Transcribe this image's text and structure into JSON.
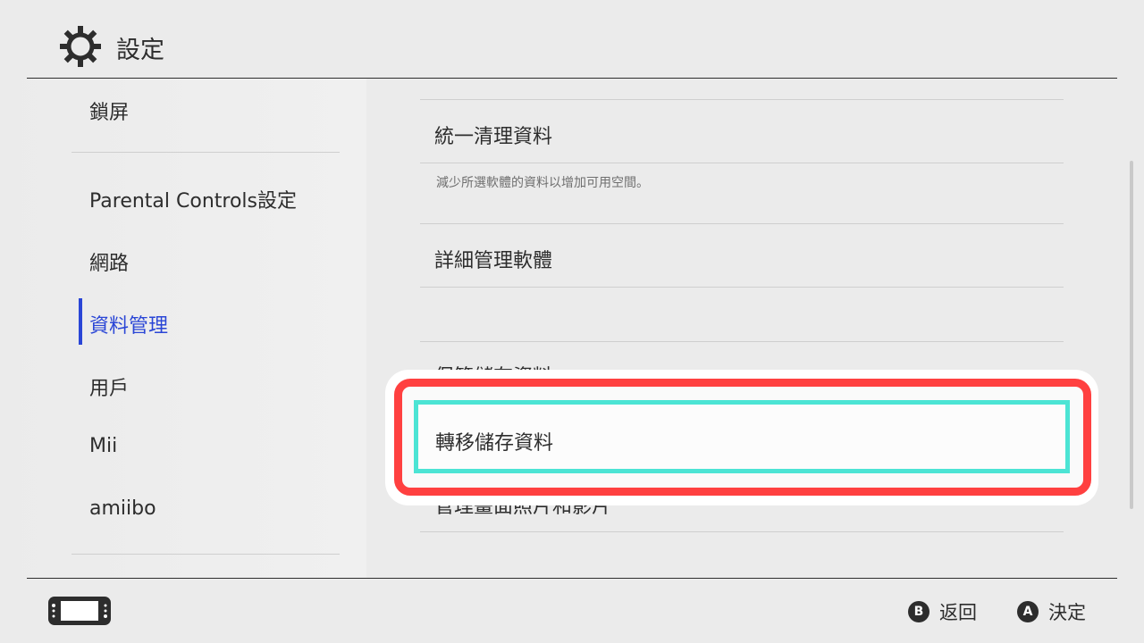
{
  "header": {
    "title": "設定",
    "icon": "gear-icon"
  },
  "sidebar": {
    "items": [
      {
        "label": "鎖屏"
      },
      {
        "label": "Parental Controls設定"
      },
      {
        "label": "網路"
      },
      {
        "label": "資料管理",
        "selected": true
      },
      {
        "label": "用戶"
      },
      {
        "label": "Mii"
      },
      {
        "label": "amiibo"
      }
    ]
  },
  "content": {
    "items": [
      {
        "label": "統一清理資料",
        "description": "減少所選軟體的資料以增加可用空間。"
      },
      {
        "label": "詳細管理軟體"
      },
      {
        "label": "保管儲存資料"
      },
      {
        "label": "轉移儲存資料",
        "focused": true
      },
      {
        "label": "管理畫面照片和影片"
      }
    ]
  },
  "footer": {
    "back": {
      "button": "B",
      "label": "返回"
    },
    "confirm": {
      "button": "A",
      "label": "決定"
    }
  },
  "colors": {
    "accent": "#2a46d6",
    "focus": "#4ce4d4",
    "annotation": "#ff4040",
    "background": "#ebebeb"
  }
}
